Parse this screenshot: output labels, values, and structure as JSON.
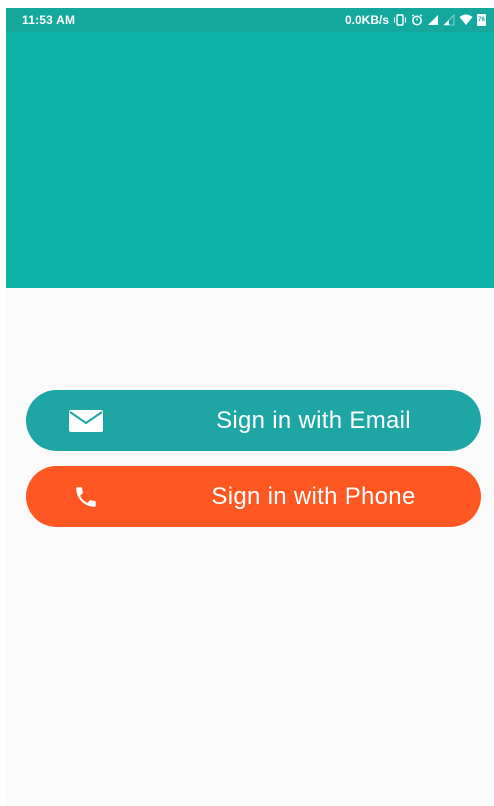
{
  "status_bar": {
    "time": "11:53 AM",
    "network_speed": "0.0KB/s",
    "battery_level": "76",
    "icons": [
      "vibrate-icon",
      "alarm-icon",
      "signal-icon",
      "signal-weak-icon",
      "wifi-icon",
      "battery-icon"
    ]
  },
  "colors": {
    "status_bar": "#13a89b",
    "header": "#0db3a6",
    "background": "#fafafa",
    "email_button": "#1ea6a4",
    "phone_button": "#ff5722",
    "button_text": "#ffffff"
  },
  "buttons": {
    "email": {
      "label": "Sign in with Email",
      "icon": "email-icon"
    },
    "phone": {
      "label": "Sign in with Phone",
      "icon": "phone-icon"
    }
  }
}
